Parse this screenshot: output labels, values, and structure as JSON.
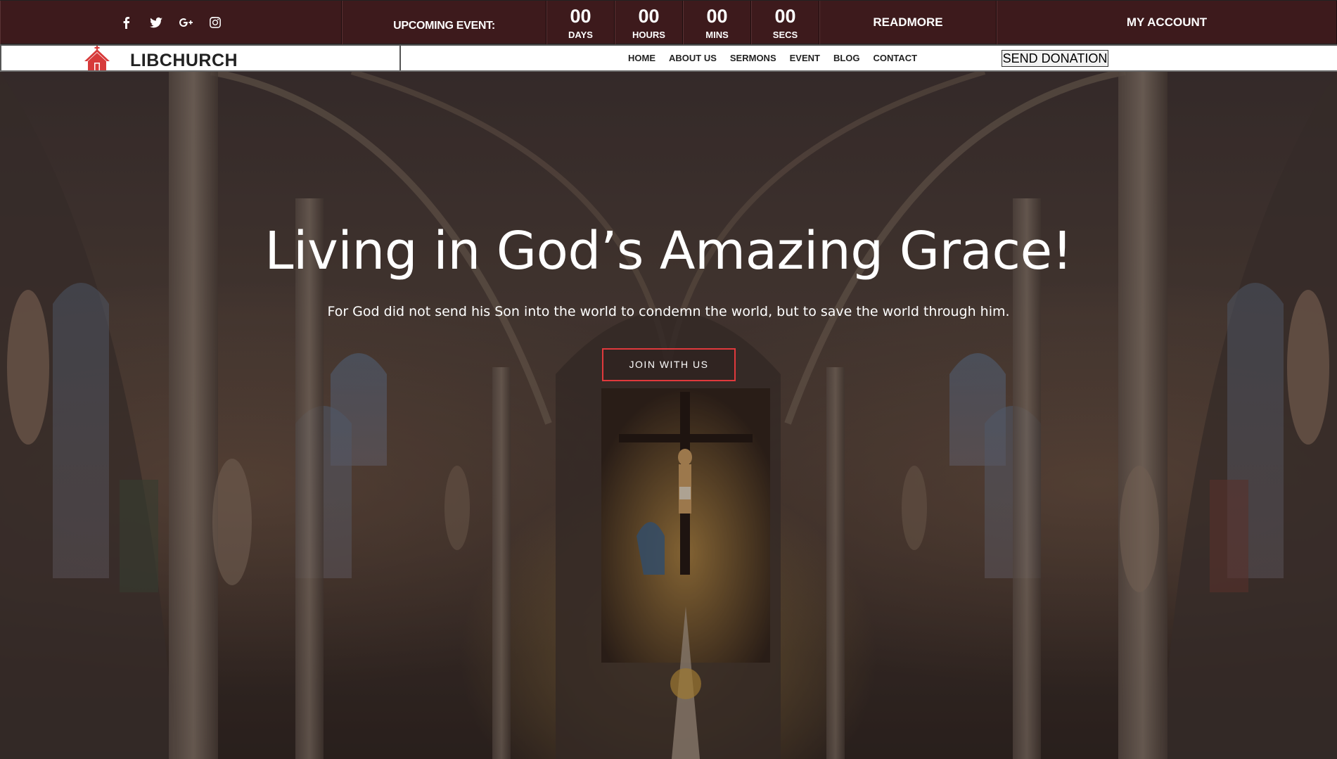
{
  "topbar": {
    "social_icons": [
      "facebook-icon",
      "twitter-icon",
      "google-plus-icon",
      "instagram-icon"
    ],
    "upcoming_label": "UPCOMING EVENT:",
    "countdown": [
      {
        "value": "00",
        "unit": "DAYS"
      },
      {
        "value": "00",
        "unit": "HOURS"
      },
      {
        "value": "00",
        "unit": "MINS"
      },
      {
        "value": "00",
        "unit": "SECS"
      }
    ],
    "readmore": "READMORE",
    "account": "MY ACCOUNT"
  },
  "nav": {
    "brand": "LIBCHURCH",
    "items": [
      "HOME",
      "ABOUT US",
      "SERMONS",
      "EVENT",
      "BLOG",
      "CONTACT"
    ],
    "donate": "SEND DONATION"
  },
  "hero": {
    "title": "Living in God’s Amazing Grace!",
    "subtitle": "For God did not send his Son into the world to condemn the world, but to save the world through him.",
    "cta": "JOIN WITH US"
  },
  "colors": {
    "topbar_bg": "#3d1a1c",
    "accent_red": "#e53c3f"
  }
}
